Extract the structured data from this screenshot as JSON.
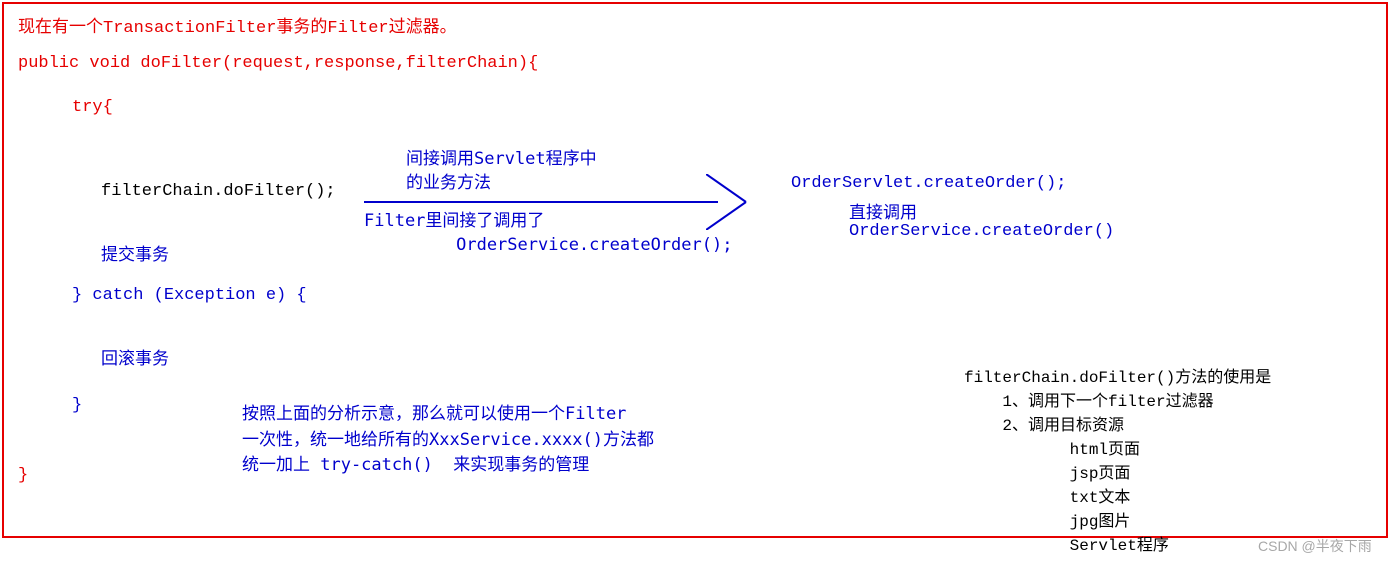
{
  "title": "现在有一个TransactionFilter事务的Filter过滤器。",
  "code": {
    "signature": "public void doFilter(request,response,filterChain){",
    "try_open": "try{",
    "doFilterCall": "filterChain.doFilter();",
    "commit": "提交事务",
    "catch_line": "} catch (Exception e) {",
    "rollback": "回滚事务",
    "brace_close_inner": "}",
    "brace_close_outer": "}"
  },
  "arrow": {
    "above": "间接调用Servlet程序中\n的业务方法",
    "below": "Filter里间接了调用了\n         OrderService.createOrder();"
  },
  "target": {
    "line1": "OrderServlet.createOrder();",
    "line2": "直接调用",
    "line3": "OrderService.createOrder()"
  },
  "analysis": "按照上面的分析示意，那么就可以使用一个Filter\n一次性，统一地给所有的XxxService.xxxx()方法都\n统一加上 try-catch()  来实现事务的管理",
  "rightNote": "filterChain.doFilter()方法的使用是\n    1、调用下一个filter过滤器\n    2、调用目标资源\n           html页面\n           jsp页面\n           txt文本\n           jpg图片\n           Servlet程序",
  "watermark": "CSDN @半夜下雨"
}
